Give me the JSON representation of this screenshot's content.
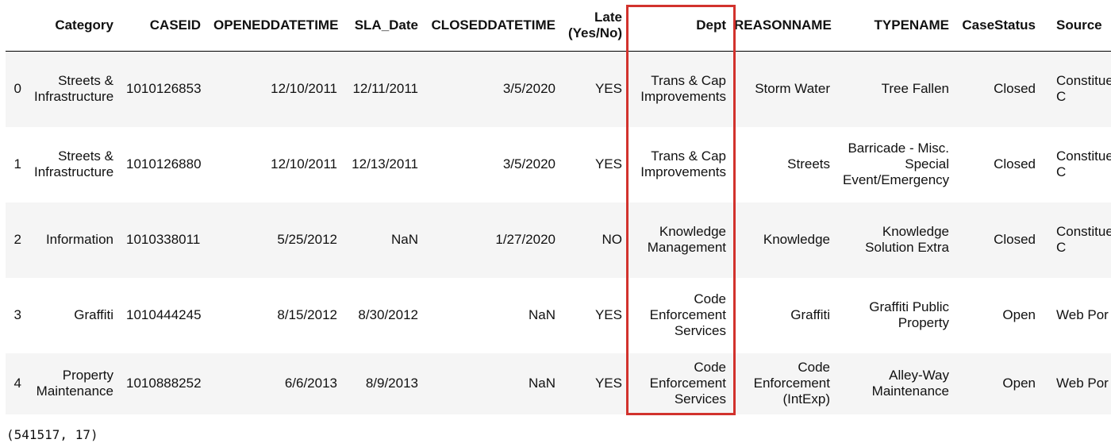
{
  "table": {
    "columns": [
      "",
      "Category",
      "CASEID",
      "OPENEDDATETIME",
      "SLA_Date",
      "CLOSEDDATETIME",
      "Late\n(Yes/No)",
      "Dept",
      "REASONNAME",
      "TYPENAME",
      "CaseStatus",
      "Source"
    ],
    "rows": [
      [
        "0",
        "Streets &\nInfrastructure",
        "1010126853",
        "12/10/2011",
        "12/11/2011",
        "3/5/2020",
        "YES",
        "Trans & Cap\nImprovements",
        "Storm Water",
        "Tree Fallen",
        "Closed",
        "Constitue\nC"
      ],
      [
        "1",
        "Streets &\nInfrastructure",
        "1010126880",
        "12/10/2011",
        "12/13/2011",
        "3/5/2020",
        "YES",
        "Trans & Cap\nImprovements",
        "Streets",
        "Barricade - Misc.\nSpecial\nEvent/Emergency",
        "Closed",
        "Constitue\nC"
      ],
      [
        "2",
        "Information",
        "1010338011",
        "5/25/2012",
        "NaN",
        "1/27/2020",
        "NO",
        "Knowledge\nManagement",
        "Knowledge",
        "Knowledge\nSolution Extra",
        "Closed",
        "Constitue\nC"
      ],
      [
        "3",
        "Graffiti",
        "1010444245",
        "8/15/2012",
        "8/30/2012",
        "NaN",
        "YES",
        "Code\nEnforcement\nServices",
        "Graffiti",
        "Graffiti Public\nProperty",
        "Open",
        "Web Por"
      ],
      [
        "4",
        "Property\nMaintenance",
        "1010888252",
        "6/6/2013",
        "8/9/2013",
        "NaN",
        "YES",
        "Code\nEnforcement\nServices",
        "Code\nEnforcement\n(IntExp)",
        "Alley-Way\nMaintenance",
        "Open",
        "Web Por"
      ]
    ]
  },
  "highlight": {
    "column": "Dept",
    "color": "#d2322d"
  },
  "output": {
    "shape": "(541517, 17)"
  }
}
